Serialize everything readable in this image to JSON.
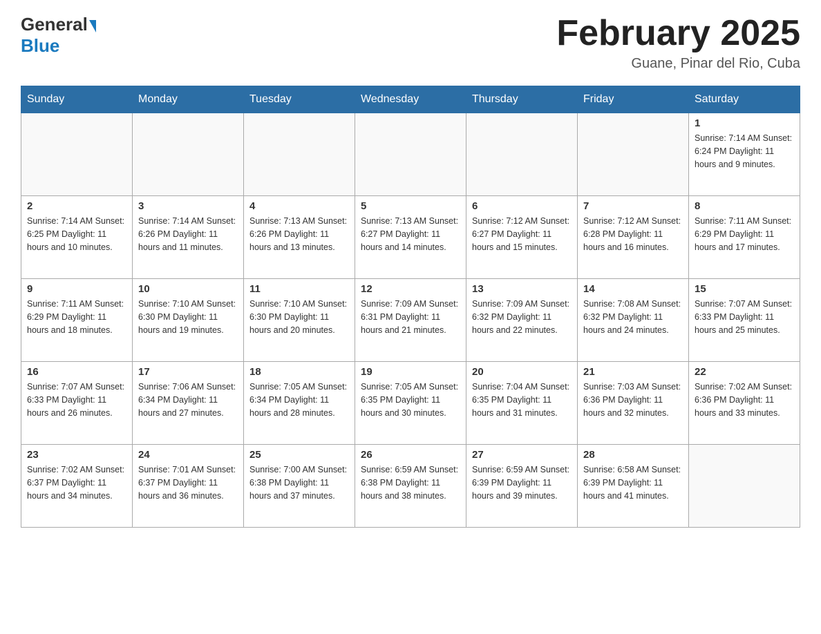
{
  "header": {
    "logo_general": "General",
    "logo_blue": "Blue",
    "month_title": "February 2025",
    "location": "Guane, Pinar del Rio, Cuba"
  },
  "days_of_week": [
    "Sunday",
    "Monday",
    "Tuesday",
    "Wednesday",
    "Thursday",
    "Friday",
    "Saturday"
  ],
  "weeks": [
    [
      {
        "day": "",
        "info": ""
      },
      {
        "day": "",
        "info": ""
      },
      {
        "day": "",
        "info": ""
      },
      {
        "day": "",
        "info": ""
      },
      {
        "day": "",
        "info": ""
      },
      {
        "day": "",
        "info": ""
      },
      {
        "day": "1",
        "info": "Sunrise: 7:14 AM\nSunset: 6:24 PM\nDaylight: 11 hours and 9 minutes."
      }
    ],
    [
      {
        "day": "2",
        "info": "Sunrise: 7:14 AM\nSunset: 6:25 PM\nDaylight: 11 hours and 10 minutes."
      },
      {
        "day": "3",
        "info": "Sunrise: 7:14 AM\nSunset: 6:26 PM\nDaylight: 11 hours and 11 minutes."
      },
      {
        "day": "4",
        "info": "Sunrise: 7:13 AM\nSunset: 6:26 PM\nDaylight: 11 hours and 13 minutes."
      },
      {
        "day": "5",
        "info": "Sunrise: 7:13 AM\nSunset: 6:27 PM\nDaylight: 11 hours and 14 minutes."
      },
      {
        "day": "6",
        "info": "Sunrise: 7:12 AM\nSunset: 6:27 PM\nDaylight: 11 hours and 15 minutes."
      },
      {
        "day": "7",
        "info": "Sunrise: 7:12 AM\nSunset: 6:28 PM\nDaylight: 11 hours and 16 minutes."
      },
      {
        "day": "8",
        "info": "Sunrise: 7:11 AM\nSunset: 6:29 PM\nDaylight: 11 hours and 17 minutes."
      }
    ],
    [
      {
        "day": "9",
        "info": "Sunrise: 7:11 AM\nSunset: 6:29 PM\nDaylight: 11 hours and 18 minutes."
      },
      {
        "day": "10",
        "info": "Sunrise: 7:10 AM\nSunset: 6:30 PM\nDaylight: 11 hours and 19 minutes."
      },
      {
        "day": "11",
        "info": "Sunrise: 7:10 AM\nSunset: 6:30 PM\nDaylight: 11 hours and 20 minutes."
      },
      {
        "day": "12",
        "info": "Sunrise: 7:09 AM\nSunset: 6:31 PM\nDaylight: 11 hours and 21 minutes."
      },
      {
        "day": "13",
        "info": "Sunrise: 7:09 AM\nSunset: 6:32 PM\nDaylight: 11 hours and 22 minutes."
      },
      {
        "day": "14",
        "info": "Sunrise: 7:08 AM\nSunset: 6:32 PM\nDaylight: 11 hours and 24 minutes."
      },
      {
        "day": "15",
        "info": "Sunrise: 7:07 AM\nSunset: 6:33 PM\nDaylight: 11 hours and 25 minutes."
      }
    ],
    [
      {
        "day": "16",
        "info": "Sunrise: 7:07 AM\nSunset: 6:33 PM\nDaylight: 11 hours and 26 minutes."
      },
      {
        "day": "17",
        "info": "Sunrise: 7:06 AM\nSunset: 6:34 PM\nDaylight: 11 hours and 27 minutes."
      },
      {
        "day": "18",
        "info": "Sunrise: 7:05 AM\nSunset: 6:34 PM\nDaylight: 11 hours and 28 minutes."
      },
      {
        "day": "19",
        "info": "Sunrise: 7:05 AM\nSunset: 6:35 PM\nDaylight: 11 hours and 30 minutes."
      },
      {
        "day": "20",
        "info": "Sunrise: 7:04 AM\nSunset: 6:35 PM\nDaylight: 11 hours and 31 minutes."
      },
      {
        "day": "21",
        "info": "Sunrise: 7:03 AM\nSunset: 6:36 PM\nDaylight: 11 hours and 32 minutes."
      },
      {
        "day": "22",
        "info": "Sunrise: 7:02 AM\nSunset: 6:36 PM\nDaylight: 11 hours and 33 minutes."
      }
    ],
    [
      {
        "day": "23",
        "info": "Sunrise: 7:02 AM\nSunset: 6:37 PM\nDaylight: 11 hours and 34 minutes."
      },
      {
        "day": "24",
        "info": "Sunrise: 7:01 AM\nSunset: 6:37 PM\nDaylight: 11 hours and 36 minutes."
      },
      {
        "day": "25",
        "info": "Sunrise: 7:00 AM\nSunset: 6:38 PM\nDaylight: 11 hours and 37 minutes."
      },
      {
        "day": "26",
        "info": "Sunrise: 6:59 AM\nSunset: 6:38 PM\nDaylight: 11 hours and 38 minutes."
      },
      {
        "day": "27",
        "info": "Sunrise: 6:59 AM\nSunset: 6:39 PM\nDaylight: 11 hours and 39 minutes."
      },
      {
        "day": "28",
        "info": "Sunrise: 6:58 AM\nSunset: 6:39 PM\nDaylight: 11 hours and 41 minutes."
      },
      {
        "day": "",
        "info": ""
      }
    ]
  ]
}
